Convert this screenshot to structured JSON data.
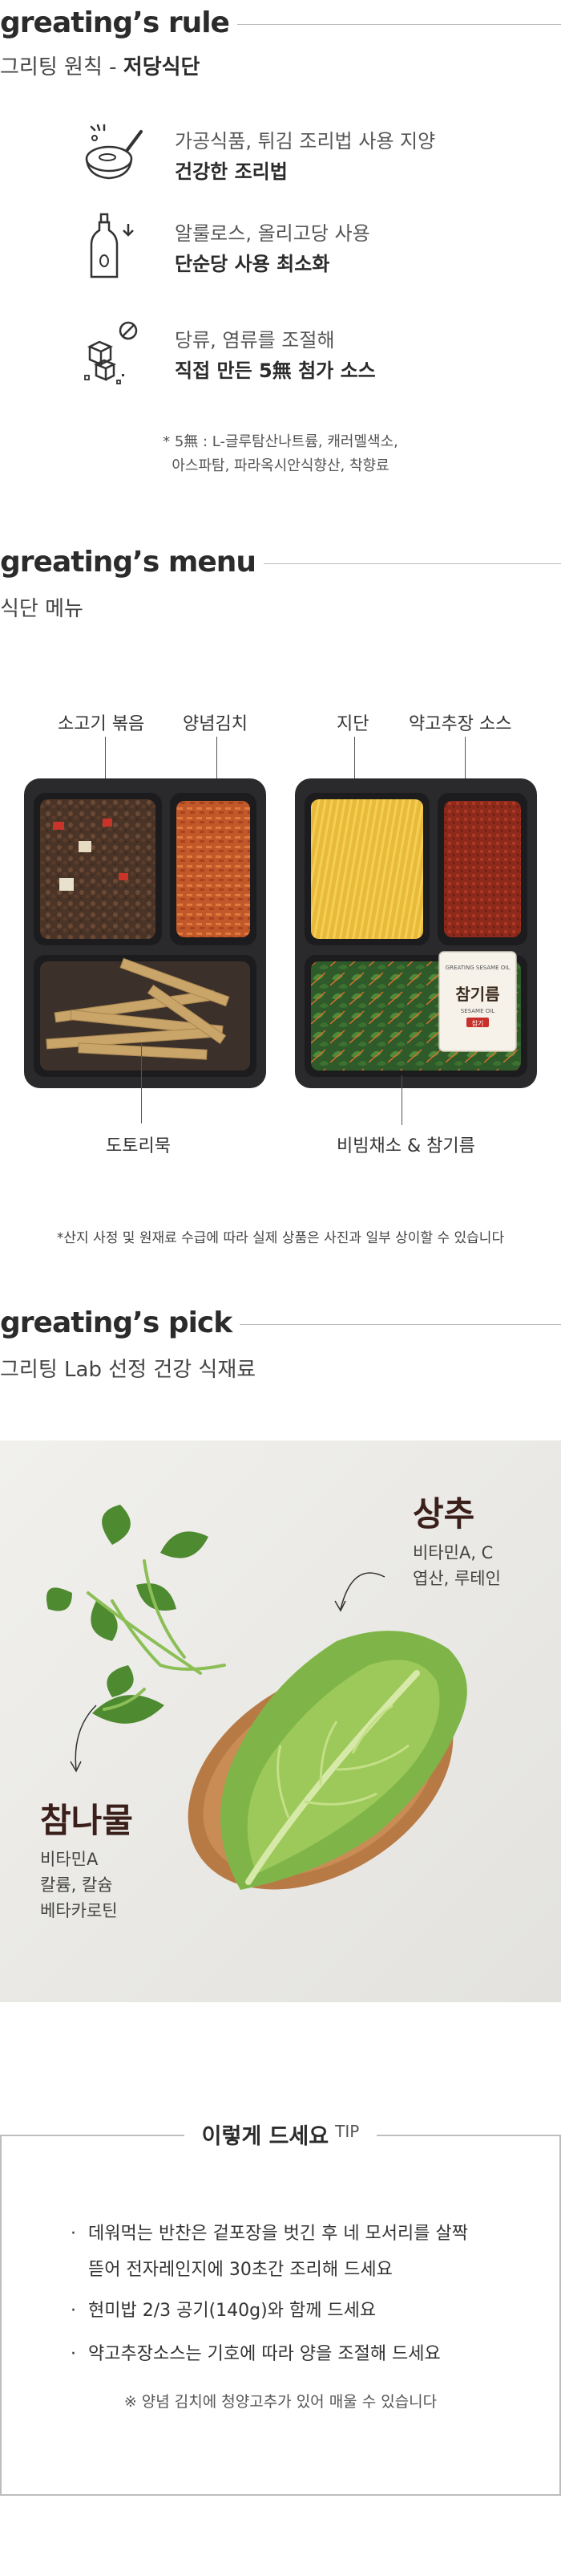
{
  "rule": {
    "title": "greating’s rule",
    "subtitle_prefix": "그리팅 원칙 - ",
    "subtitle_bold": "저당식단",
    "items": [
      {
        "icon": "frying-pan-icon",
        "line1": "가공식품, 튀김 조리법 사용 지양",
        "line2": "건강한 조리법"
      },
      {
        "icon": "oil-bottle-icon",
        "line1": "알룰로스, 올리고당 사용",
        "line2": "단순당 사용 최소화"
      },
      {
        "icon": "sugar-cube-icon",
        "line1": "당류, 염류를 조절해",
        "line2": "직접 만든 5無 첨가 소스"
      }
    ],
    "note_line1": "* 5無 : L-글루탐산나트륨, 캐러멜색소,",
    "note_line2": "아스파탐, 파라옥시안식향산, 착향료"
  },
  "menu": {
    "title": "greating’s menu",
    "subtitle": "식단 메뉴",
    "labels": {
      "beef": "소고기 볶음",
      "kimchi": "양념김치",
      "egg": "지단",
      "sauce": "약고추장 소스",
      "acorn": "도토리묵",
      "greens": "비빔채소 & 참기름"
    },
    "sesame_pack": {
      "brand": "GREATING SESAME OIL",
      "korean": "참기름",
      "sub": "SESAME OIL",
      "badge": "참기"
    },
    "disclaimer": "*산지 사정 및 원재료 수급에 따라 실제 상품은 사진과 일부 상이할 수 있습니다"
  },
  "pick": {
    "title": "greating’s pick",
    "subtitle": "그리팅 Lab 선정 건강 식재료",
    "lettuce": {
      "name": "상추",
      "line1": "비타민A, C",
      "line2": "엽산, 루테인"
    },
    "chamnamul": {
      "name": "참나물",
      "line1": "비타민A",
      "line2": "칼륨, 칼슘",
      "line3": "베타카로틴"
    }
  },
  "tip": {
    "title": "이렇게 드세요",
    "sup": "TIP",
    "items": [
      {
        "line1": "데워먹는 반찬은 겉포장을 벗긴 후 네 모서리를 살짝",
        "line2": "뜯어 전자레인지에 30초간 조리해 드세요"
      },
      {
        "line1": "현미밥 2/3 공기(140g)와 함께 드세요"
      },
      {
        "line1": "약고추장소스는 기호에 따라 양을 조절해 드세요"
      }
    ],
    "note": "※ 양념 김치에 청양고추가 있어 매울 수 있습니다"
  }
}
